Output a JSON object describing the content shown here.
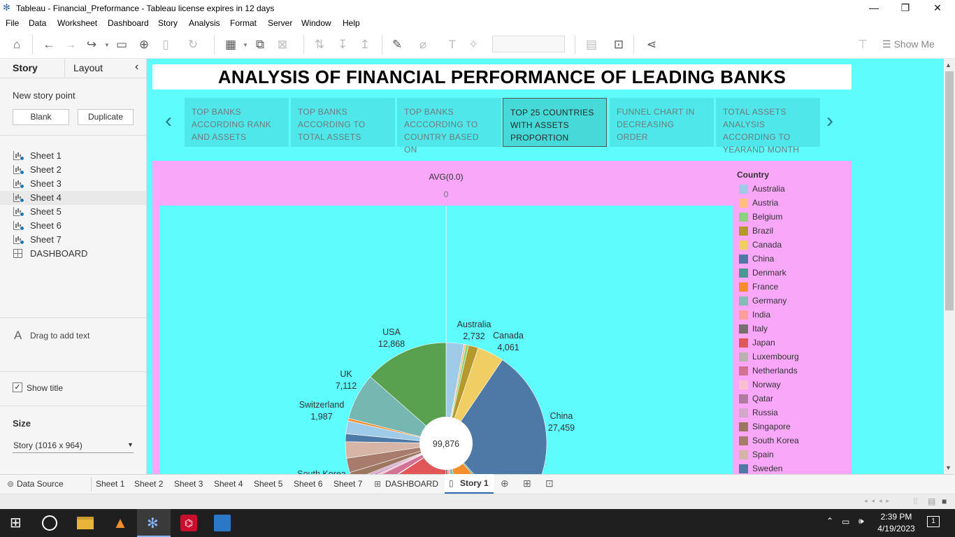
{
  "window": {
    "title": "Tableau - Financial_Preformance - Tableau license expires in 12 days",
    "minimize": "—",
    "restore": "❐",
    "close": "✕"
  },
  "menu": [
    "File",
    "Data",
    "Worksheet",
    "Dashboard",
    "Story",
    "Analysis",
    "Format",
    "Server",
    "Window",
    "Help"
  ],
  "toolbar": {
    "show_me": "Show Me"
  },
  "sidebar": {
    "tab_story": "Story",
    "tab_layout": "Layout",
    "collapse": "‹",
    "new_story_point": "New story point",
    "blank_button": "Blank",
    "duplicate_button": "Duplicate",
    "sheets": [
      "Sheet 1",
      "Sheet 2",
      "Sheet 3",
      "Sheet 4",
      "Sheet 5",
      "Sheet 6",
      "Sheet 7"
    ],
    "dashboard": "DASHBOARD",
    "drag_text": "Drag to add text",
    "show_title": "Show title",
    "size_heading": "Size",
    "size_value": "Story (1016 x 964)"
  },
  "story": {
    "title": "ANALYSIS OF FINANCIAL PERFORMANCE OF LEADING BANKS",
    "points": [
      "TOP BANKS ACCORDING RANK AND ASSETS",
      "TOP BANKS ACCORDING TO TOTAL ASSETS",
      "TOP BANKS ACCCORDING TO COUNTRY BASED ON",
      "TOP 25 COUNTRIES WITH ASSETS PROPORTION",
      "FUNNEL CHART IN DECREASING ORDER",
      "TOTAL ASSETS ANALYSIS ACCORDING TO YEARAND MONTH"
    ],
    "active_index": 3,
    "prev_arrow": "‹",
    "next_arrow": "›"
  },
  "viz": {
    "axis_title": "AVG(0.0)",
    "axis_tick": "0",
    "legend_title": "Country",
    "legend": [
      {
        "name": "Australia",
        "color": "#a0cbe8"
      },
      {
        "name": "Austria",
        "color": "#ffbe7d"
      },
      {
        "name": "Belgium",
        "color": "#8cd17d"
      },
      {
        "name": "Brazil",
        "color": "#b6992d"
      },
      {
        "name": "Canada",
        "color": "#f1ce63"
      },
      {
        "name": "China",
        "color": "#4e79a7"
      },
      {
        "name": "Denmark",
        "color": "#499894"
      },
      {
        "name": "France",
        "color": "#f28e2b"
      },
      {
        "name": "Germany",
        "color": "#86bcb6"
      },
      {
        "name": "India",
        "color": "#ff9d9a"
      },
      {
        "name": "Italy",
        "color": "#79706e"
      },
      {
        "name": "Japan",
        "color": "#e15759"
      },
      {
        "name": "Luxembourg",
        "color": "#bab0ac"
      },
      {
        "name": "Netherlands",
        "color": "#d37295"
      },
      {
        "name": "Norway",
        "color": "#fabfd2"
      },
      {
        "name": "Qatar",
        "color": "#b07aa1"
      },
      {
        "name": "Russia",
        "color": "#d4a6c8"
      },
      {
        "name": "Singapore",
        "color": "#9d7660"
      },
      {
        "name": "South Korea",
        "color": "#a87c6d"
      },
      {
        "name": "Spain",
        "color": "#d7b5a6"
      },
      {
        "name": "Sweden",
        "color": "#4e79a7"
      }
    ]
  },
  "chart_data": {
    "type": "pie",
    "title": "",
    "center_total": "99,876",
    "slices": [
      {
        "label": "Australia",
        "value": 2732,
        "color": "#a0cbe8",
        "shown_label": true
      },
      {
        "label": "Austria",
        "value": 300,
        "color": "#ffbe7d",
        "shown_label": false
      },
      {
        "label": "Belgium",
        "value": 400,
        "color": "#8cd17d",
        "shown_label": false
      },
      {
        "label": "Brazil",
        "value": 1500,
        "color": "#b6992d",
        "shown_label": false
      },
      {
        "label": "Canada",
        "value": 4061,
        "color": "#f1ce63",
        "shown_label": true
      },
      {
        "label": "China",
        "value": 27459,
        "color": "#4e79a7",
        "shown_label": true
      },
      {
        "label": "Denmark",
        "value": 500,
        "color": "#499894",
        "shown_label": false
      },
      {
        "label": "France",
        "value": 7100,
        "color": "#f28e2b",
        "shown_label": false
      },
      {
        "label": "Germany",
        "value": 1600,
        "color": "#86bcb6",
        "shown_label": false
      },
      {
        "label": "India",
        "value": 1000,
        "color": "#ff9d9a",
        "shown_label": false
      },
      {
        "label": "Italy",
        "value": 1000,
        "color": "#79706e",
        "shown_label": false
      },
      {
        "label": "Japan",
        "value": 15000,
        "color": "#e15759",
        "shown_label": false
      },
      {
        "label": "Luxembourg",
        "value": 150,
        "color": "#bab0ac",
        "shown_label": false
      },
      {
        "label": "Netherlands",
        "value": 1800,
        "color": "#d37295",
        "shown_label": false
      },
      {
        "label": "Norway",
        "value": 400,
        "color": "#fabfd2",
        "shown_label": false
      },
      {
        "label": "Qatar",
        "value": 300,
        "color": "#b07aa1",
        "shown_label": false
      },
      {
        "label": "Russia",
        "value": 400,
        "color": "#d4a6c8",
        "shown_label": false
      },
      {
        "label": "Singapore",
        "value": 1200,
        "color": "#9d7660",
        "shown_label": false
      },
      {
        "label": "South Korea",
        "value": 2200,
        "color": "#a87c6d",
        "shown_label": false
      },
      {
        "label": "Spain",
        "value": 2500,
        "color": "#d7b5a6",
        "shown_label": false
      },
      {
        "label": "Sweden",
        "value": 1200,
        "color": "#4e79a7",
        "shown_label": false
      },
      {
        "label": "Switzerland",
        "value": 1987,
        "color": "#a0cbe8",
        "shown_label": true
      },
      {
        "label": "(other)",
        "value": 379,
        "color": "#f28e2b",
        "shown_label": false
      },
      {
        "label": "UK",
        "value": 7112,
        "color": "#76b7b2",
        "shown_label": true
      },
      {
        "label": "USA",
        "value": 12868,
        "color": "#59a14f",
        "shown_label": true
      }
    ],
    "partially_visible_label": "South Korea"
  },
  "bottom_tabs": {
    "data_source": "Data Source",
    "sheets": [
      "Sheet 1",
      "Sheet 2",
      "Sheet 3",
      "Sheet 4",
      "Sheet 5",
      "Sheet 6",
      "Sheet 7"
    ],
    "dashboard": "DASHBOARD",
    "story": "Story 1"
  },
  "taskbar": {
    "time": "2:39 PM",
    "date": "4/19/2023",
    "notification_count": "1"
  }
}
